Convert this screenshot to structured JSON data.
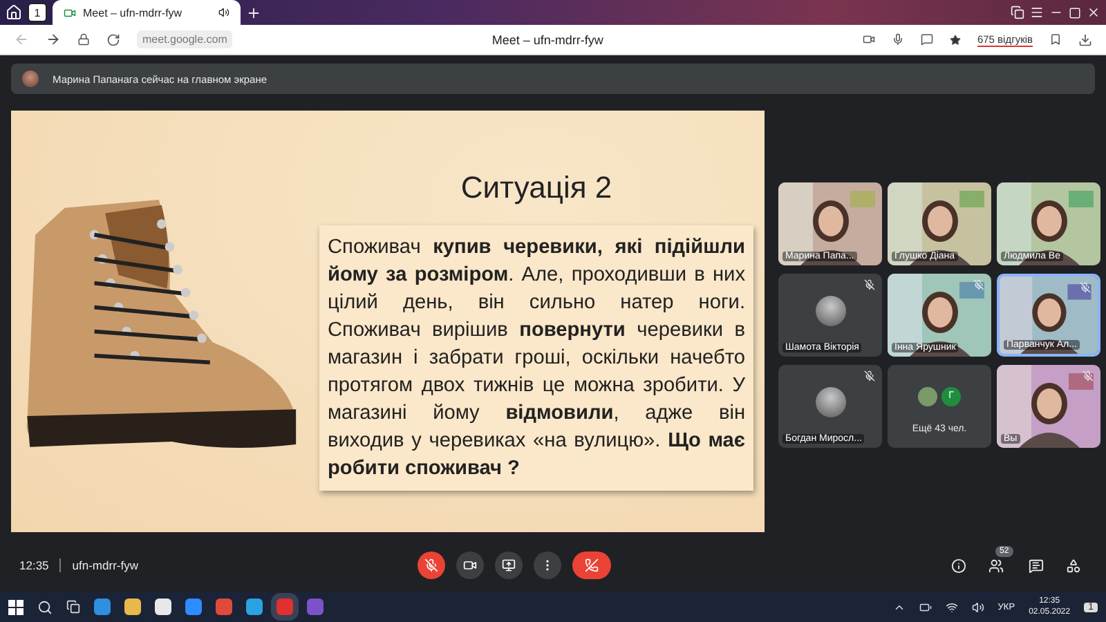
{
  "browser": {
    "tab_count": "1",
    "tab_title": "Meet – ufn-mdrr-fyw",
    "url": "meet.google.com",
    "page_title": "Meet – ufn-mdrr-fyw",
    "reviews": "675 відгуків"
  },
  "banner": {
    "text": "Марина Папанага сейчас на главном экране"
  },
  "slide": {
    "title": "Ситуація 2",
    "body": "Споживач **купив черевики, які підійшли йому за розміром**. Але, проходивши в них цілий день, він сильно натер ноги. Споживач вирішив **повернути** черевики в магазин і забрати гроші, оскільки начебто протягом двох тижнів це можна зробити. У магазині йому **відмовили**, адже він виходив у черевиках «на вулицю». **Що має робити споживач ?**"
  },
  "tiles": [
    {
      "kind": "video",
      "name": "Марина Папа...",
      "muted": false,
      "speaking": false
    },
    {
      "kind": "video",
      "name": "Глушко Діана",
      "muted": false,
      "speaking": false
    },
    {
      "kind": "video",
      "name": "Людмила Ве",
      "muted": false,
      "speaking": false
    },
    {
      "kind": "avatar",
      "name": "Шамота Вікторія",
      "muted": true,
      "speaking": false
    },
    {
      "kind": "video",
      "name": "Інна Ярушник",
      "muted": true,
      "speaking": false
    },
    {
      "kind": "video",
      "name": "Парванчук Ал...",
      "muted": true,
      "speaking": true
    },
    {
      "kind": "avatar",
      "name": "Богдан Миросл...",
      "muted": true,
      "speaking": false
    },
    {
      "kind": "more",
      "name": "Ещё 43 чел.",
      "initial": "Г",
      "muted": false,
      "speaking": false
    },
    {
      "kind": "video",
      "name": "Вы",
      "muted": true,
      "speaking": false
    }
  ],
  "controls": {
    "time": "12:35",
    "meeting_code": "ufn-mdrr-fyw",
    "mic_on": false,
    "people_count": "52"
  },
  "taskbar": {
    "language": "УКР",
    "time": "12:35",
    "date": "02.05.2022",
    "notifications": "1"
  }
}
